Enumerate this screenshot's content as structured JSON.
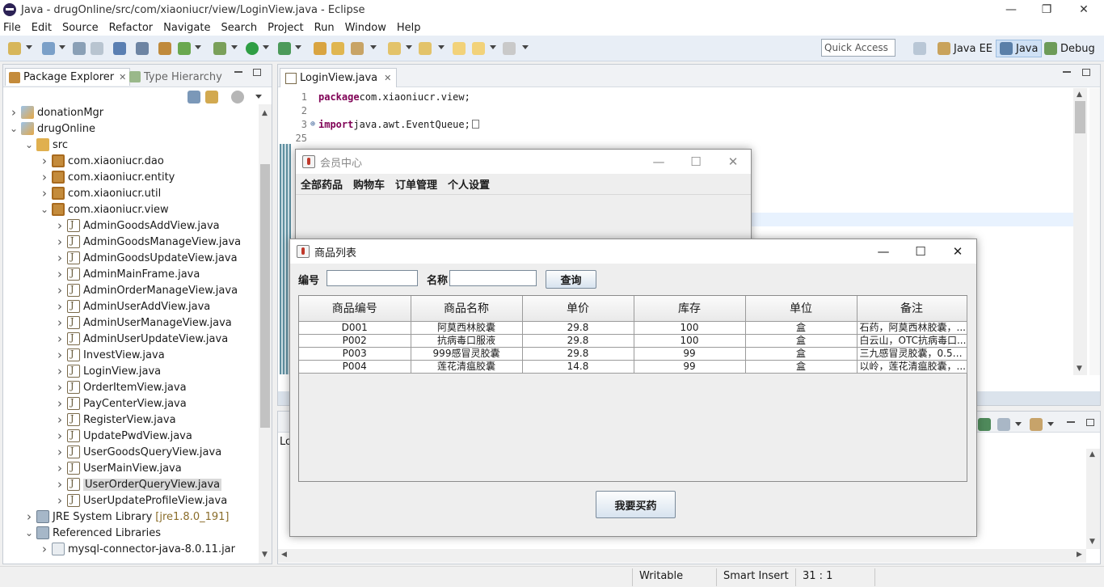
{
  "window": {
    "title": "Java - drugOnline/src/com/xiaoniucr/view/LoginView.java - Eclipse"
  },
  "menu": [
    "File",
    "Edit",
    "Source",
    "Refactor",
    "Navigate",
    "Search",
    "Project",
    "Run",
    "Window",
    "Help"
  ],
  "toolbar": {
    "quick_access": "Quick Access",
    "perspectives": [
      "Java EE",
      "Java",
      "Debug"
    ]
  },
  "package_explorer": {
    "tab_label": "Package Explorer",
    "other_tab": "Type Hierarchy",
    "tree": [
      {
        "label": "donationMgr",
        "icon": "project-icon",
        "expanded": false
      },
      {
        "label": "drugOnline",
        "icon": "project-icon",
        "expanded": true
      },
      {
        "label": "src",
        "icon": "source-folder-icon",
        "expanded": true
      },
      {
        "label": "com.xiaoniucr.dao",
        "icon": "package-icon",
        "expanded": false
      },
      {
        "label": "com.xiaoniucr.entity",
        "icon": "package-icon",
        "expanded": false
      },
      {
        "label": "com.xiaoniucr.util",
        "icon": "package-icon",
        "expanded": false
      },
      {
        "label": "com.xiaoniucr.view",
        "icon": "package-icon",
        "expanded": true
      },
      {
        "label": "AdminGoodsAddView.java",
        "icon": "java-file-icon"
      },
      {
        "label": "AdminGoodsManageView.java",
        "icon": "java-file-icon"
      },
      {
        "label": "AdminGoodsUpdateView.java",
        "icon": "java-file-icon"
      },
      {
        "label": "AdminMainFrame.java",
        "icon": "java-file-icon"
      },
      {
        "label": "AdminOrderManageView.java",
        "icon": "java-file-icon"
      },
      {
        "label": "AdminUserAddView.java",
        "icon": "java-file-icon"
      },
      {
        "label": "AdminUserManageView.java",
        "icon": "java-file-icon"
      },
      {
        "label": "AdminUserUpdateView.java",
        "icon": "java-file-icon"
      },
      {
        "label": "InvestView.java",
        "icon": "java-file-icon"
      },
      {
        "label": "LoginView.java",
        "icon": "java-file-icon"
      },
      {
        "label": "OrderItemView.java",
        "icon": "java-file-icon"
      },
      {
        "label": "PayCenterView.java",
        "icon": "java-file-icon"
      },
      {
        "label": "RegisterView.java",
        "icon": "java-file-icon"
      },
      {
        "label": "UpdatePwdView.java",
        "icon": "java-file-icon"
      },
      {
        "label": "UserGoodsQueryView.java",
        "icon": "java-file-icon"
      },
      {
        "label": "UserMainView.java",
        "icon": "java-file-icon"
      },
      {
        "label": "UserOrderQueryView.java",
        "icon": "java-file-icon",
        "selected": true
      },
      {
        "label": "UserUpdateProfileView.java",
        "icon": "java-file-icon"
      },
      {
        "label": "JRE System Library",
        "suffix": "[jre1.8.0_191]",
        "icon": "library-icon",
        "expanded": false
      },
      {
        "label": "Referenced Libraries",
        "icon": "library-icon",
        "expanded": true
      },
      {
        "label": "mysql-connector-java-8.0.11.jar",
        "icon": "jar-icon",
        "expanded": false
      }
    ]
  },
  "editor": {
    "tab_label": "LoginView.java",
    "lines": [
      {
        "num": "1",
        "kw": "package",
        "text": " com.xiaoniucr.view;"
      },
      {
        "num": "2",
        "kw": "",
        "text": ""
      },
      {
        "num": "3",
        "kw": "import",
        "text": " java.awt.EventQueue;"
      },
      {
        "num": "25",
        "kw": "",
        "text": ""
      }
    ]
  },
  "bottom_panel": {
    "label": "Lo"
  },
  "status": {
    "writable": "Writable",
    "insert_mode": "Smart Insert",
    "position": "31 : 1"
  },
  "member_window": {
    "title": "会员中心",
    "menu": [
      "全部药品",
      "购物车",
      "订单管理",
      "个人设置"
    ]
  },
  "goods_window": {
    "title": "商品列表",
    "id_label": "编号",
    "name_label": "名称",
    "id_value": "",
    "name_value": "",
    "query_button": "查询",
    "buy_button": "我要买药",
    "columns": [
      "商品编号",
      "商品名称",
      "单价",
      "库存",
      "单位",
      "备注"
    ],
    "rows": [
      [
        "D001",
        "阿莫西林胶囊",
        "29.8",
        "100",
        "盒",
        "石药，阿莫西林胶囊，..."
      ],
      [
        "P002",
        "抗病毒口服液",
        "29.8",
        "100",
        "盒",
        "白云山，OTC抗病毒口..."
      ],
      [
        "P003",
        "999感冒灵胶囊",
        "29.8",
        "99",
        "盒",
        "三九感冒灵胶囊，0.5G..."
      ],
      [
        "P004",
        "莲花清瘟胶囊",
        "14.8",
        "99",
        "盒",
        "以岭，莲花清瘟胶囊，..."
      ]
    ]
  }
}
